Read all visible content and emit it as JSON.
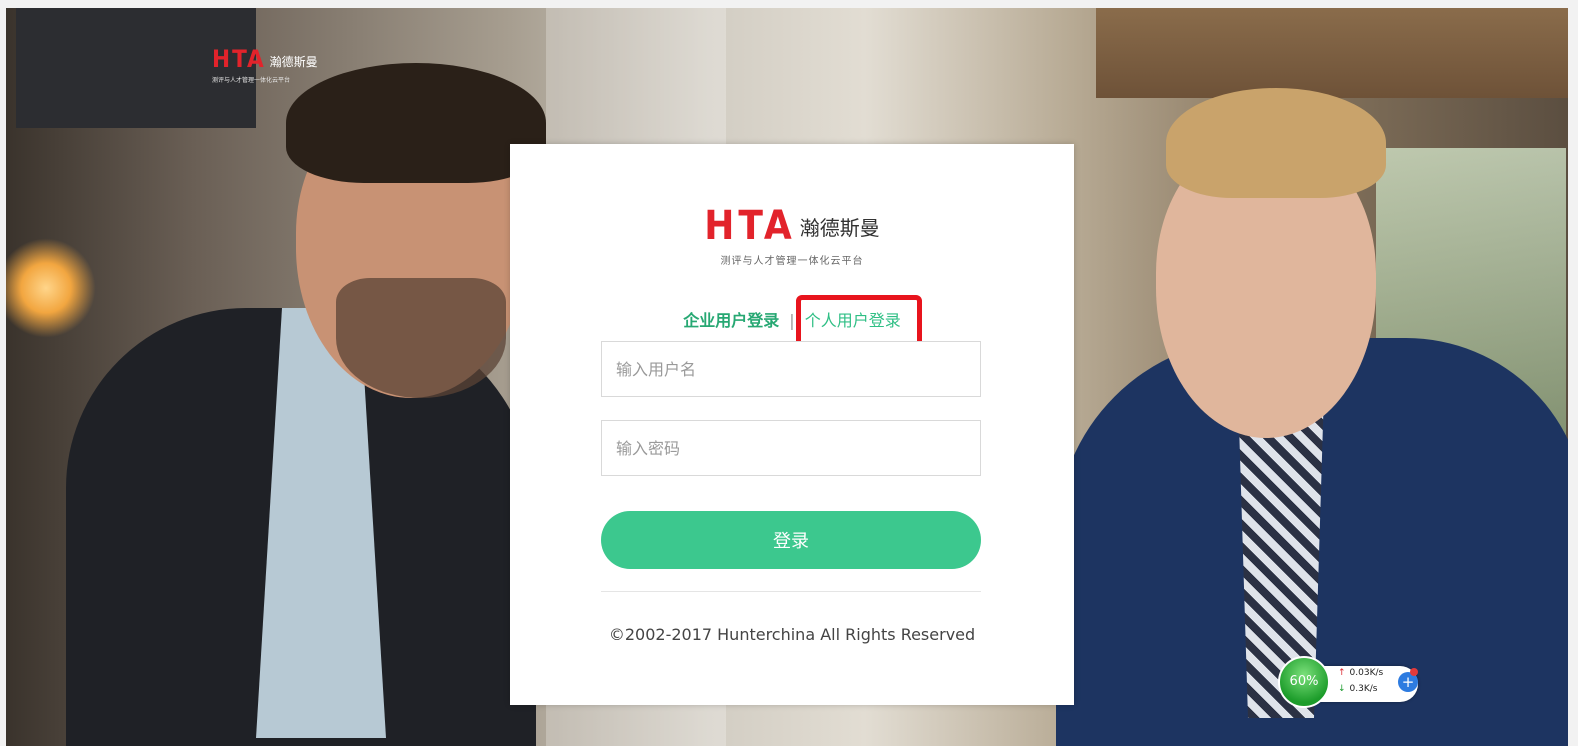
{
  "corner_logo": {
    "hta": "HTA",
    "cn": "瀚德斯曼",
    "sub": "测评与人才管理一体化云平台"
  },
  "card": {
    "logo_hta": "HTA",
    "logo_cn": "瀚德斯曼",
    "logo_sub": "测评与人才管理一体化云平台",
    "tabs": [
      {
        "label": "企业用户登录",
        "active": true
      },
      {
        "label": "个人用户登录",
        "active": false
      }
    ],
    "tab_separator": "|",
    "username_placeholder": "输入用户名",
    "password_placeholder": "输入密码",
    "login_button": "登录",
    "copyright": "©2002-2017 Hunterchina All Rights Reserved"
  },
  "net_widget": {
    "percent": "60%",
    "upload": "0.03K/s",
    "download": "0.3K/s",
    "plus": "+"
  },
  "colors": {
    "accent": "#3cc88e",
    "brand_red": "#e2232b",
    "highlight": "#e8141d"
  }
}
